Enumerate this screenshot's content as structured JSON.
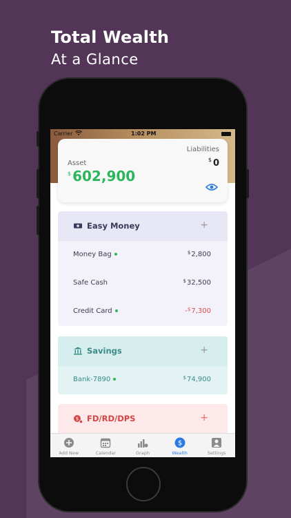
{
  "promo": {
    "headline": "Total Wealth",
    "subheadline": "At a Glance"
  },
  "status_bar": {
    "carrier": "Carrier",
    "time": "1:02 PM"
  },
  "summary": {
    "asset_label": "Asset",
    "asset_currency": "$",
    "asset_value": "602,900",
    "liabilities_label": "Liabilities",
    "liabilities_currency": "$",
    "liabilities_value": "0",
    "visibility_icon": "eye-icon"
  },
  "sections": {
    "easy_money": {
      "title": "Easy Money",
      "icon": "banknote-icon",
      "add_label": "+",
      "rows": [
        {
          "name": "Money Bag",
          "currency": "$",
          "amount": "2,800",
          "sign": ""
        },
        {
          "name": "Safe Cash",
          "currency": "$",
          "amount": "32,500",
          "sign": ""
        },
        {
          "name": "Credit Card",
          "currency": "$",
          "amount": "7,300",
          "sign": "-"
        }
      ]
    },
    "savings": {
      "title": "Savings",
      "icon": "bank-icon",
      "add_label": "+",
      "rows": [
        {
          "name": "Bank-7890",
          "currency": "$",
          "amount": "74,900",
          "sign": ""
        }
      ]
    },
    "fd": {
      "title": "FD/RD/DPS",
      "icon": "deposit-icon",
      "add_label": "+"
    }
  },
  "tabs": [
    {
      "label": "Add New",
      "icon": "plus-circle-icon"
    },
    {
      "label": "Calendar",
      "icon": "calendar-icon"
    },
    {
      "label": "Graph",
      "icon": "graph-icon"
    },
    {
      "label": "Wealth",
      "icon": "dollar-circle-icon"
    },
    {
      "label": "Settings",
      "icon": "person-icon"
    }
  ],
  "colors": {
    "background": "#523557",
    "asset_green": "#2db55d",
    "negative_red": "#e24b4b",
    "active_tab_blue": "#2c7be5"
  }
}
